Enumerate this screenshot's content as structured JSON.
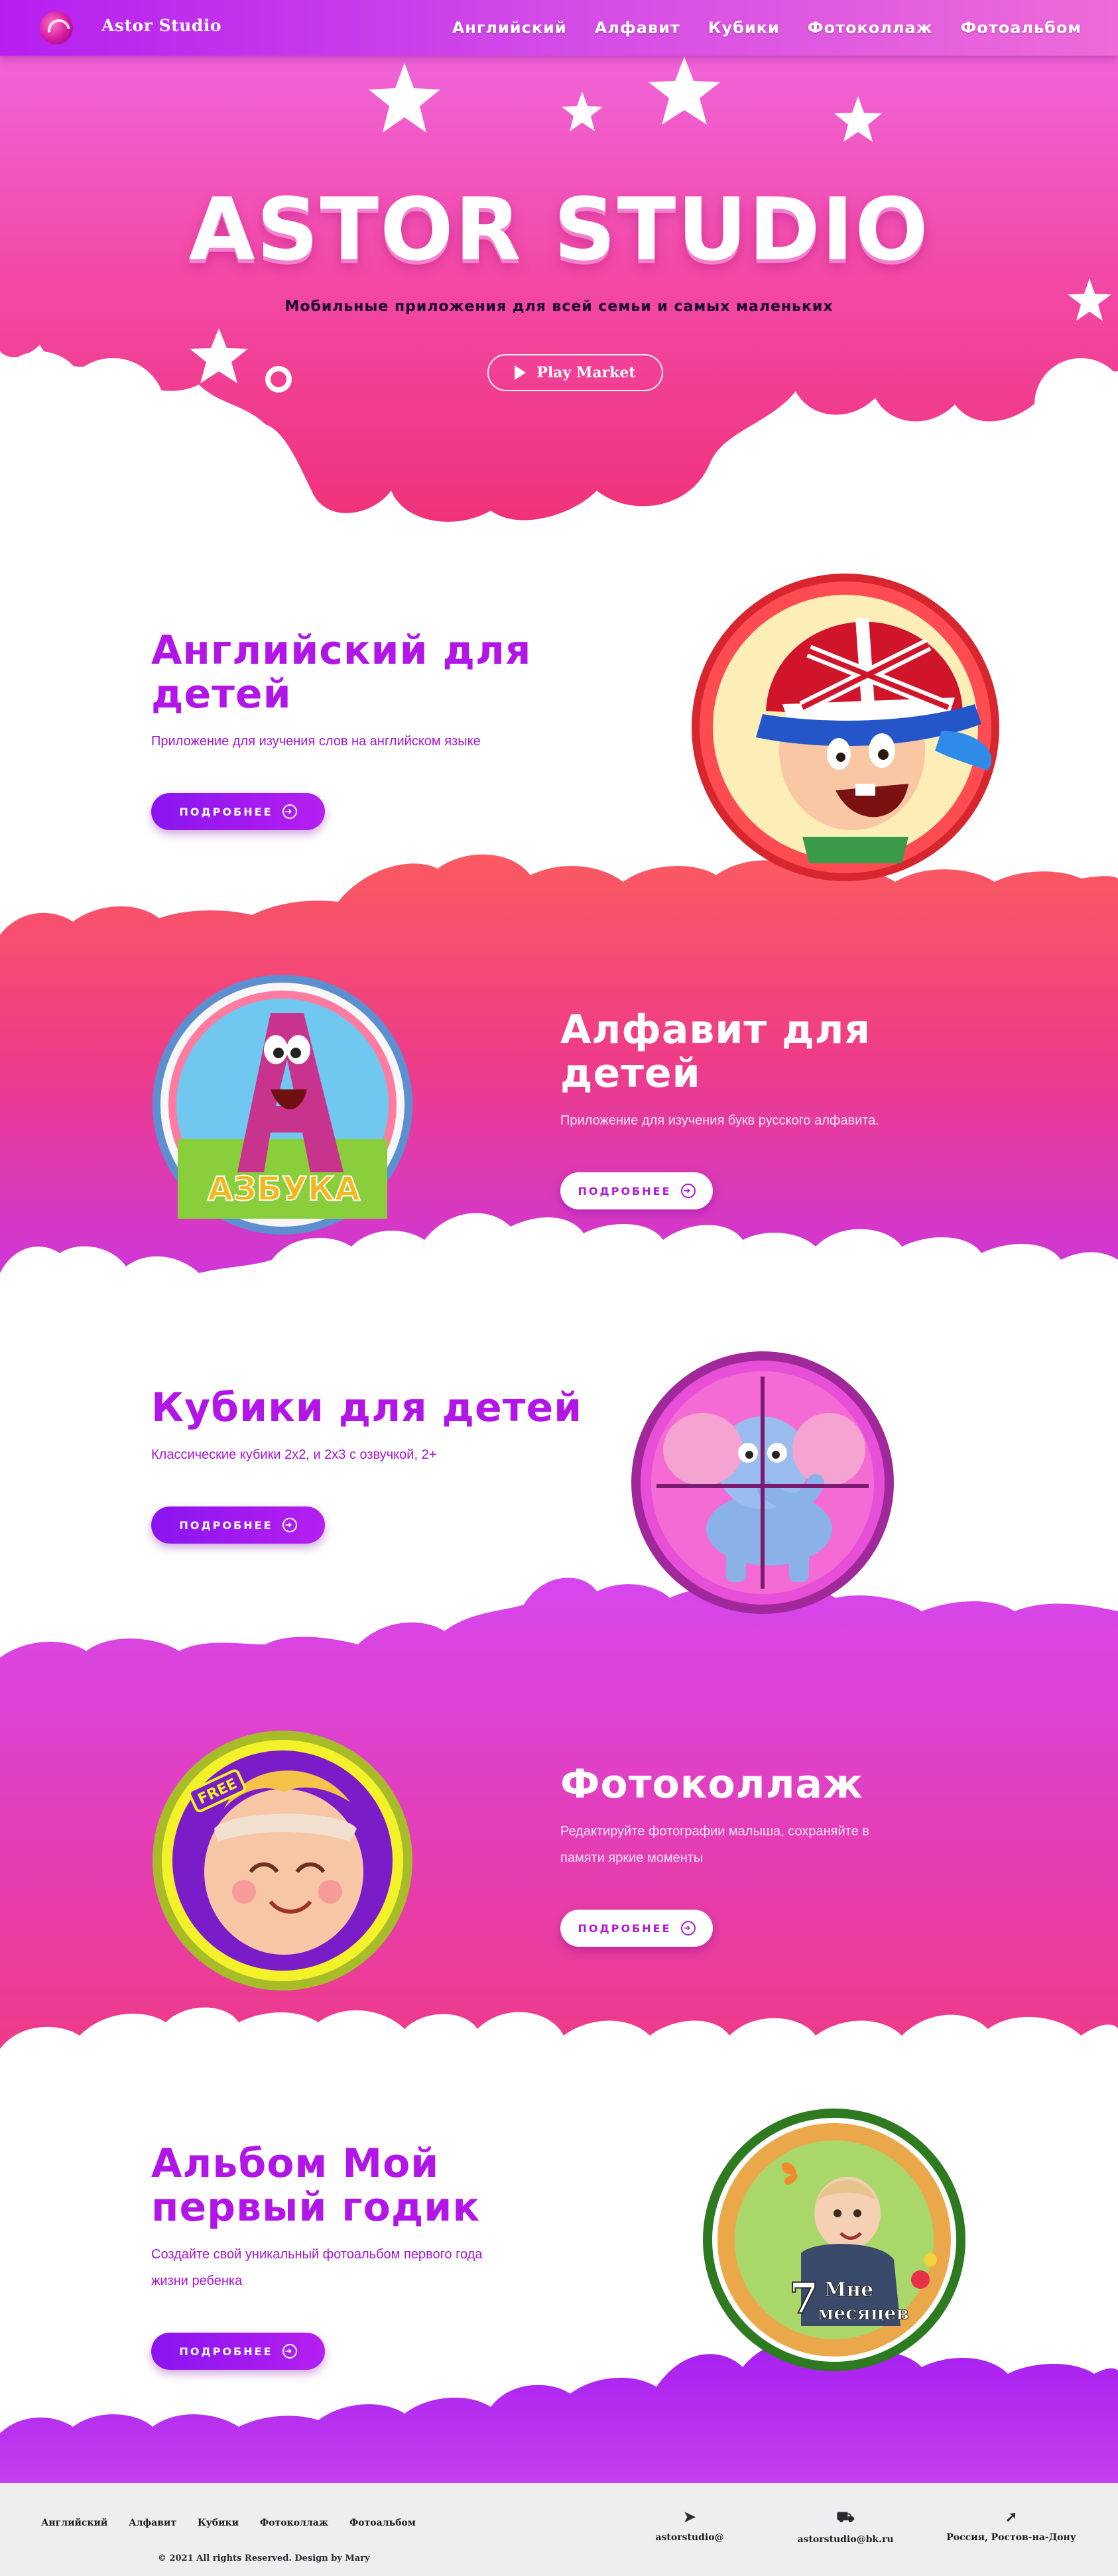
{
  "navbar": {
    "brand": "Astor Studio",
    "items": [
      {
        "label": "Английский"
      },
      {
        "label": "Алфавит"
      },
      {
        "label": "Кубики"
      },
      {
        "label": "Фотоколлаж"
      },
      {
        "label": "Фотоальбом"
      }
    ]
  },
  "hero": {
    "title": "ASTOR STUDIO",
    "subtitle": "Мобильные приложения для всей семьи и самых маленьких",
    "button_label": "Play Market"
  },
  "apps": [
    {
      "title_line1": "Английский для",
      "title_line2": "детей",
      "description": "Приложение для изучения слов на английском языке",
      "button_label": "ПОДРОБНЕЕ",
      "icon": "boy-with-british-cap-icon"
    },
    {
      "title_line1": "Алфавит для",
      "title_line2": "детей",
      "description": "Приложение для изучения букв русского алфавита.",
      "button_label": "ПОДРОБНЕЕ",
      "icon": "letter-a-character-icon",
      "icon_text": "АЗБУКА"
    },
    {
      "title_line1": "Кубики для детей",
      "title_line2": "",
      "description": "Классические кубики 2х2, и 2х3 с озвучкой, 2+",
      "button_label": "ПОДРОБНЕЕ",
      "icon": "elephant-puzzle-icon"
    },
    {
      "title_line1": "Фотоколлаж",
      "title_line2": "",
      "description_line1": "Редактируйте фотографии малыша, сохраняйте в",
      "description_line2": "памяти яркие моменты",
      "button_label": "ПОДРОБНЕЕ",
      "icon": "baby-face-icon",
      "icon_badge": "FREE"
    },
    {
      "title_line1": "Альбом Мой",
      "title_line2": "первый годик",
      "description_line1": "Создайте свой уникальный фотоальбом первого года",
      "description_line2": "жизни ребенка",
      "button_label": "ПОДРОБНЕЕ",
      "icon": "baby-photo-frame-icon",
      "icon_text_number": "7",
      "icon_text_line1": "Мне",
      "icon_text_line2": "месяцев"
    }
  ],
  "footer": {
    "links": [
      "Английский",
      "Алфавит",
      "Кубики",
      "Фотоколлаж",
      "Фотоальбом"
    ],
    "contacts": [
      {
        "icon": "telegram-icon",
        "text": "astorstudio@"
      },
      {
        "icon": "mail-truck-icon",
        "text": "astorstudio@bk.ru"
      },
      {
        "icon": "location-arrow-icon",
        "text": "Россия, Ростов-на-Дону"
      }
    ],
    "copyright": "© 2021 All rights Reserved. Design by Mary"
  },
  "colors": {
    "navbar_start": "#b61ff0",
    "navbar_end": "#ee6ad8",
    "hero_top": "#f468e2",
    "hero_bottom": "#f0357f",
    "section_red": "#fb5b63",
    "section_purple": "#d53ee9",
    "section_pink": "#ee3a93",
    "accent_text": "#b215e8"
  }
}
